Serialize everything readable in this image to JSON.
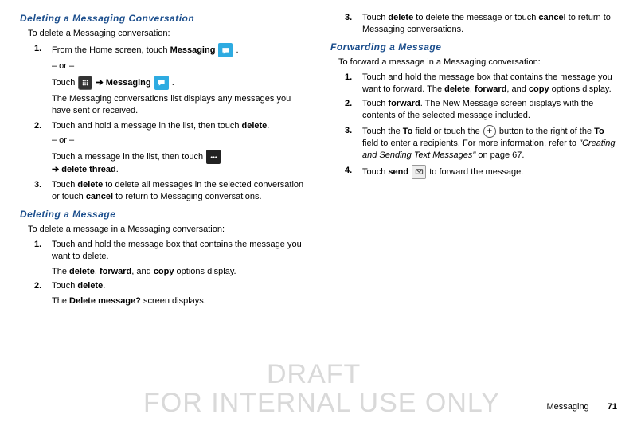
{
  "watermark": {
    "draft": "DRAFT",
    "internal": "FOR INTERNAL USE ONLY"
  },
  "footer": {
    "section": "Messaging",
    "page": "71"
  },
  "left": {
    "heading1": "Deleting a Messaging Conversation",
    "intro1": "To delete a Messaging conversation:",
    "s1_num": "1.",
    "s1_a": "From the Home screen, touch ",
    "s1_b": "Messaging",
    "s1_c": " .",
    "or": "– or –",
    "s1_d": "Touch ",
    "s1_e": " ➔ ",
    "s1_f": "Messaging",
    "s1_g": " .",
    "s1_h": "The Messaging conversations list displays any messages you have sent or received.",
    "s2_num": "2.",
    "s2_a": "Touch and hold a message in the list, then touch ",
    "s2_b": "delete",
    "s2_c": ".",
    "s2_d": "Touch a message in the list, then touch ",
    "s2_e": " ➔ ",
    "s2_f": "delete thread",
    "s2_g": ".",
    "s3_num": "3.",
    "s3_a": "Touch ",
    "s3_b": "delete",
    "s3_c": " to delete all messages in the selected conversation or touch ",
    "s3_d": "cancel",
    "s3_e": " to return to Messaging conversations.",
    "heading2": "Deleting a Message",
    "intro2": "To delete a message in a Messaging conversation:",
    "m1_num": "1.",
    "m1_a": "Touch and hold the message box that contains the message you want to delete.",
    "m1_b": "The ",
    "m1_c": "delete",
    "m1_d": ", ",
    "m1_e": "forward",
    "m1_f": ", and ",
    "m1_g": "copy",
    "m1_h": " options display.",
    "m2_num": "2.",
    "m2_a": "Touch ",
    "m2_b": "delete",
    "m2_c": ".",
    "m2_d": "The ",
    "m2_e": "Delete message?",
    "m2_f": " screen displays."
  },
  "right": {
    "r3_num": "3.",
    "r3_a": "Touch ",
    "r3_b": "delete",
    "r3_c": " to delete the message or touch ",
    "r3_d": "cancel",
    "r3_e": " to return to Messaging conversations.",
    "heading3": "Forwarding a Message",
    "intro3": "To forward a message in a Messaging conversation:",
    "f1_num": "1.",
    "f1_a": "Touch and hold the message box that contains the message you want to forward. The ",
    "f1_b": "delete",
    "f1_c": ", ",
    "f1_d": "forward",
    "f1_e": ", and ",
    "f1_f": "copy",
    "f1_g": " options display.",
    "f2_num": "2.",
    "f2_a": "Touch ",
    "f2_b": "forward",
    "f2_c": ". The New Message screen displays with the contents of the selected message included.",
    "f3_num": "3.",
    "f3_a": "Touch the ",
    "f3_b": "To",
    "f3_c": " field or touch the ",
    "f3_d": " button to the right of the ",
    "f3_e": "To",
    "f3_f": " field to enter a recipients. For more information, refer to ",
    "f3_g": "\"Creating and Sending Text Messages\"",
    "f3_h": "  on page 67.",
    "f4_num": "4.",
    "f4_a": "Touch ",
    "f4_b": "send",
    "f4_c": " to forward the message."
  }
}
